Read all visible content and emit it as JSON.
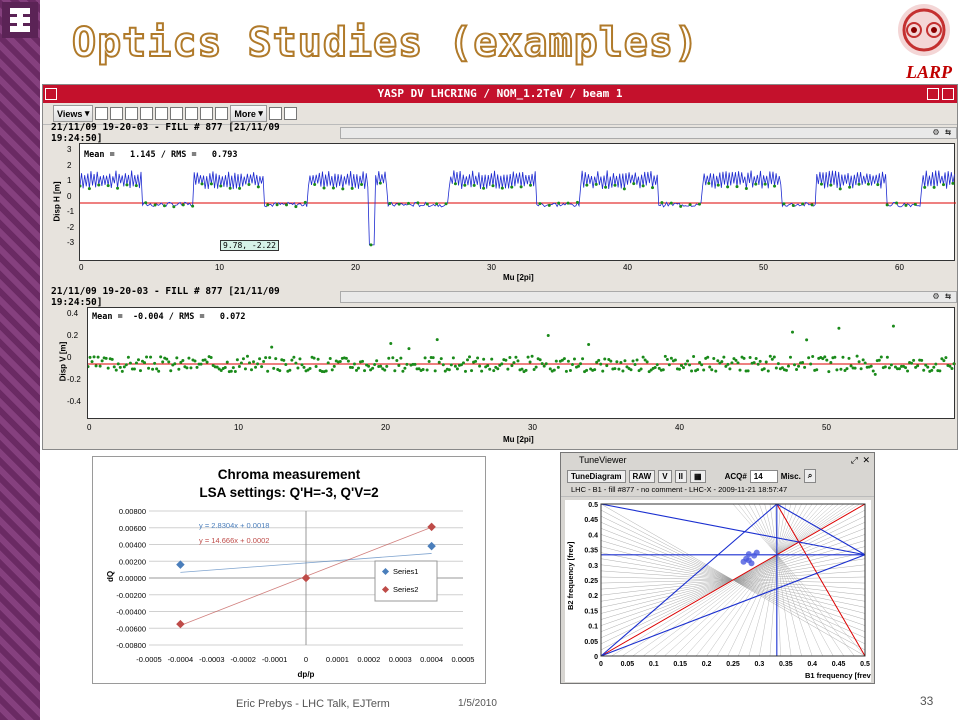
{
  "slide": {
    "title": "Optics Studies (examples)",
    "logo_text": "LARP",
    "footer_author": "Eric Prebys - LHC Talk, EJTerm",
    "footer_date": "1/5/2010",
    "page_number": "33"
  },
  "yasp": {
    "window_title": "YASP DV LHCRING / NOM_1.2TeV / beam 1",
    "toolbar": {
      "views_label": "Views",
      "more_label": "More"
    },
    "panel_h": {
      "header": "21/11/09 19-20-03 - FILL # 877  [21/11/09 19:24:50]",
      "stats": "Mean =   1.145 / RMS =   0.793",
      "tooltip": "9.78, -2.22",
      "ylabel": "Disp H [m]",
      "xlabel": "Mu [2pi]",
      "yticks": [
        "3",
        "2",
        "1",
        "0",
        "-1",
        "-2",
        "-3"
      ],
      "xticks": [
        "0",
        "10",
        "20",
        "30",
        "40",
        "50",
        "60"
      ]
    },
    "panel_v": {
      "header": "21/11/09 19-20-03 - FILL # 877  [21/11/09 19:24:50]",
      "stats": "Mean =  -0.004 / RMS =   0.072",
      "ylabel": "Disp V [m]",
      "xlabel": "Mu [2pi]",
      "yticks": [
        "0.4",
        "0.2",
        "0",
        "-0.2",
        "-0.4"
      ],
      "xticks": [
        "0",
        "10",
        "20",
        "30",
        "40",
        "50"
      ]
    }
  },
  "chroma": {
    "title_line1": "Chroma measurement",
    "title_line2": "LSA settings: Q'H=-3, Q'V=2",
    "eq1": "y = 2.8304x + 0.0018",
    "eq2": "y = 14.666x + 0.0002",
    "xlabel": "dp/p",
    "ylabel": "dQ",
    "legend": [
      "Series1",
      "Series2"
    ],
    "yticks": [
      "0.00800",
      "0.00600",
      "0.00400",
      "0.00200",
      "0.00000",
      "-0.00200",
      "-0.00400",
      "-0.00600",
      "-0.00800"
    ],
    "xticks": [
      "-0.0005",
      "-0.0004",
      "-0.0003",
      "-0.0002",
      "-0.0001",
      "0",
      "0.0001",
      "0.0002",
      "0.0003",
      "0.0004",
      "0.0005"
    ]
  },
  "tune": {
    "window_title": "TuneViewer",
    "tools": [
      "TuneDiagram",
      "RAW",
      "V",
      "II",
      "ACQ#",
      "14",
      "Misc."
    ],
    "info": "LHC - B1 - fill #877 - no comment - LHC-X - 2009-11-21 18:57:47",
    "xlabel": "B1 frequency [frev]",
    "ylabel": "B2 frequency [frev]",
    "xticks": [
      "0",
      "0.05",
      "0.1",
      "0.15",
      "0.2",
      "0.25",
      "0.3",
      "0.35",
      "0.4",
      "0.45",
      "0.5"
    ],
    "yticks": [
      "0.5",
      "0.45",
      "0.4",
      "0.35",
      "0.3",
      "0.25",
      "0.2",
      "0.15",
      "0.1",
      "0.05",
      "0"
    ]
  },
  "chart_data": [
    {
      "type": "scatter",
      "title": "Chroma measurement",
      "subtitle": "LSA settings: Q'H=-3, Q'V=2",
      "xlabel": "dp/p",
      "ylabel": "dQ",
      "xlim": [
        -0.0005,
        0.0005
      ],
      "ylim": [
        -0.008,
        0.008
      ],
      "legend": "right",
      "series": [
        {
          "name": "Series1",
          "color": "#4a7ebb",
          "x": [
            -0.0004,
            0.0004
          ],
          "y": [
            0.0016,
            0.0038
          ]
        },
        {
          "name": "Series2",
          "color": "#be4b48",
          "x": [
            -0.0004,
            0.0,
            0.0004
          ],
          "y": [
            -0.0055,
            0.0,
            0.0061
          ]
        }
      ]
    }
  ]
}
